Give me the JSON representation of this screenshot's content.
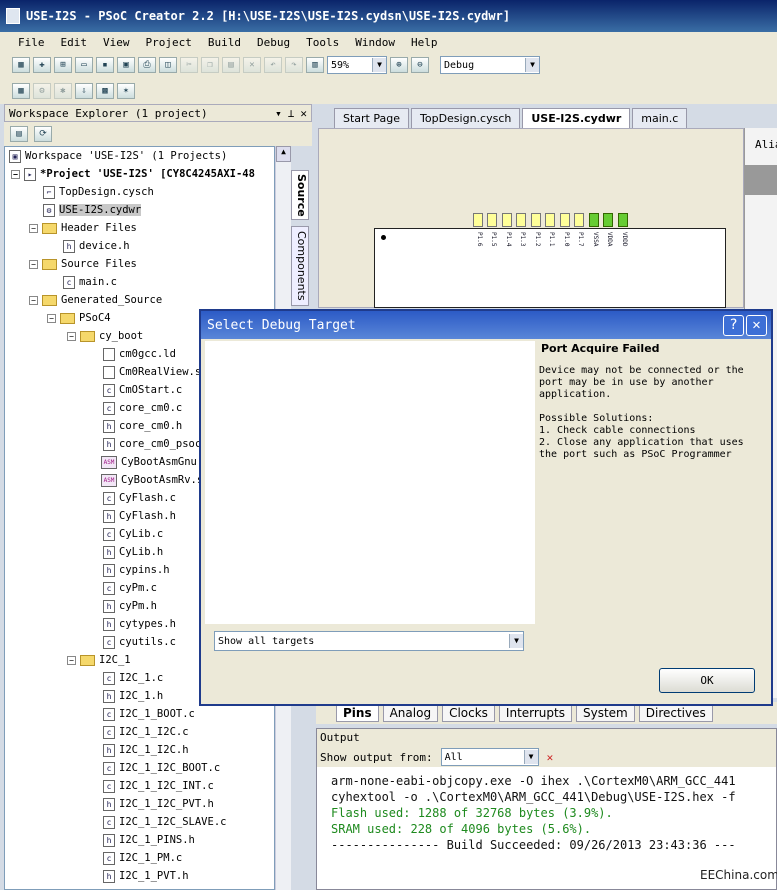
{
  "window": {
    "title": "USE-I2S - PSoC Creator 2.2  [H:\\USE-I2S\\USE-I2S.cydsn\\USE-I2S.cydwr]"
  },
  "menu": [
    "File",
    "Edit",
    "View",
    "Project",
    "Build",
    "Debug",
    "Tools",
    "Window",
    "Help"
  ],
  "toolbar": {
    "zoom": "59%",
    "config": "Debug"
  },
  "workspace": {
    "header": "Workspace Explorer (1 project)",
    "items": [
      {
        "label": "Workspace 'USE-I2S' (1 Projects)",
        "icon": "workspace-icon"
      },
      {
        "label": "*Project 'USE-I2S' [CY8C4245AXI-48",
        "icon": "project-icon"
      },
      {
        "label": "TopDesign.cysch",
        "icon": "schematic-icon"
      },
      {
        "label": "USE-I2S.cydwr",
        "icon": "dwr-icon"
      },
      {
        "label": "Header Files",
        "icon": "folder-icon"
      },
      {
        "label": "device.h",
        "icon": "h-file-icon"
      },
      {
        "label": "Source Files",
        "icon": "folder-icon"
      },
      {
        "label": "main.c",
        "icon": "c-file-icon"
      },
      {
        "label": "Generated_Source",
        "icon": "folder-icon"
      },
      {
        "label": "PSoC4",
        "icon": "folder-icon"
      },
      {
        "label": "cy_boot",
        "icon": "folder-icon"
      },
      {
        "label": "cm0gcc.ld",
        "icon": "file-icon"
      },
      {
        "label": "Cm0RealView.s",
        "icon": "file-icon"
      },
      {
        "label": "CmOStart.c",
        "icon": "c-file-icon"
      },
      {
        "label": "core_cm0.c",
        "icon": "c-file-icon"
      },
      {
        "label": "core_cm0.h",
        "icon": "h-file-icon"
      },
      {
        "label": "core_cm0_psoc",
        "icon": "h-file-icon"
      },
      {
        "label": "CyBootAsmGnu.",
        "icon": "asm-file-icon"
      },
      {
        "label": "CyBootAsmRv.s",
        "icon": "asm-file-icon"
      },
      {
        "label": "CyFlash.c",
        "icon": "c-file-icon"
      },
      {
        "label": "CyFlash.h",
        "icon": "h-file-icon"
      },
      {
        "label": "CyLib.c",
        "icon": "c-file-icon"
      },
      {
        "label": "CyLib.h",
        "icon": "h-file-icon"
      },
      {
        "label": "cypins.h",
        "icon": "h-file-icon"
      },
      {
        "label": "cyPm.c",
        "icon": "c-file-icon"
      },
      {
        "label": "cyPm.h",
        "icon": "h-file-icon"
      },
      {
        "label": "cytypes.h",
        "icon": "h-file-icon"
      },
      {
        "label": "cyutils.c",
        "icon": "c-file-icon"
      },
      {
        "label": "I2C_1",
        "icon": "folder-icon"
      },
      {
        "label": "I2C_1.c",
        "icon": "c-file-icon"
      },
      {
        "label": "I2C_1.h",
        "icon": "h-file-icon"
      },
      {
        "label": "I2C_1_BOOT.c",
        "icon": "c-file-icon"
      },
      {
        "label": "I2C_1_I2C.c",
        "icon": "c-file-icon"
      },
      {
        "label": "I2C_1_I2C.h",
        "icon": "h-file-icon"
      },
      {
        "label": "I2C_1_I2C_BOOT.c",
        "icon": "c-file-icon"
      },
      {
        "label": "I2C_1_I2C_INT.c",
        "icon": "c-file-icon"
      },
      {
        "label": "I2C_1_I2C_PVT.h",
        "icon": "h-file-icon"
      },
      {
        "label": "I2C_1_I2C_SLAVE.c",
        "icon": "c-file-icon"
      },
      {
        "label": "I2C_1_PINS.h",
        "icon": "h-file-icon"
      },
      {
        "label": "I2C_1_PM.c",
        "icon": "c-file-icon"
      },
      {
        "label": "I2C_1_PVT.h",
        "icon": "h-file-icon"
      }
    ]
  },
  "sidetabs": [
    "Source",
    "Components"
  ],
  "doc_tabs": [
    "Start Page",
    "TopDesign.cysch",
    "USE-I2S.cydwr",
    "main.c"
  ],
  "right_panel_label": "Alia",
  "pins": [
    "P1.6",
    "P1.5",
    "P1.4",
    "P1.3",
    "P1.2",
    "P1.1",
    "P1.0",
    "P1.7",
    "VSSA",
    "VDDA",
    "VDDD"
  ],
  "dialog": {
    "title": "Select Debug Target",
    "info_title": "Port Acquire Failed",
    "info_body": "Device may not be connected or the port may be in use by another application.",
    "solutions_title": "Possible Solutions:",
    "solution_1": "1. Check cable connections",
    "solution_2": "2. Close any application that uses the port such as PSoC Programmer",
    "filter": "Show all targets",
    "ok": "OK"
  },
  "bottom_tabs": [
    "Pins",
    "Analog",
    "Clocks",
    "Interrupts",
    "System",
    "Directives"
  ],
  "output": {
    "header": "Output",
    "from_label": "Show output from:",
    "from_value": "All",
    "line1": "arm-none-eabi-objcopy.exe -O ihex .\\CortexM0\\ARM_GCC_441",
    "line2": "cyhextool -o .\\CortexM0\\ARM_GCC_441\\Debug\\USE-I2S.hex -f",
    "line3": "Flash used: 1288 of 32768 bytes (3.9%).",
    "line4": "SRAM used: 228 of 4096 bytes (5.6%).",
    "line5": "--------------- Build Succeeded: 09/26/2013 23:43:36 ---"
  },
  "watermark": "EEChina.com"
}
